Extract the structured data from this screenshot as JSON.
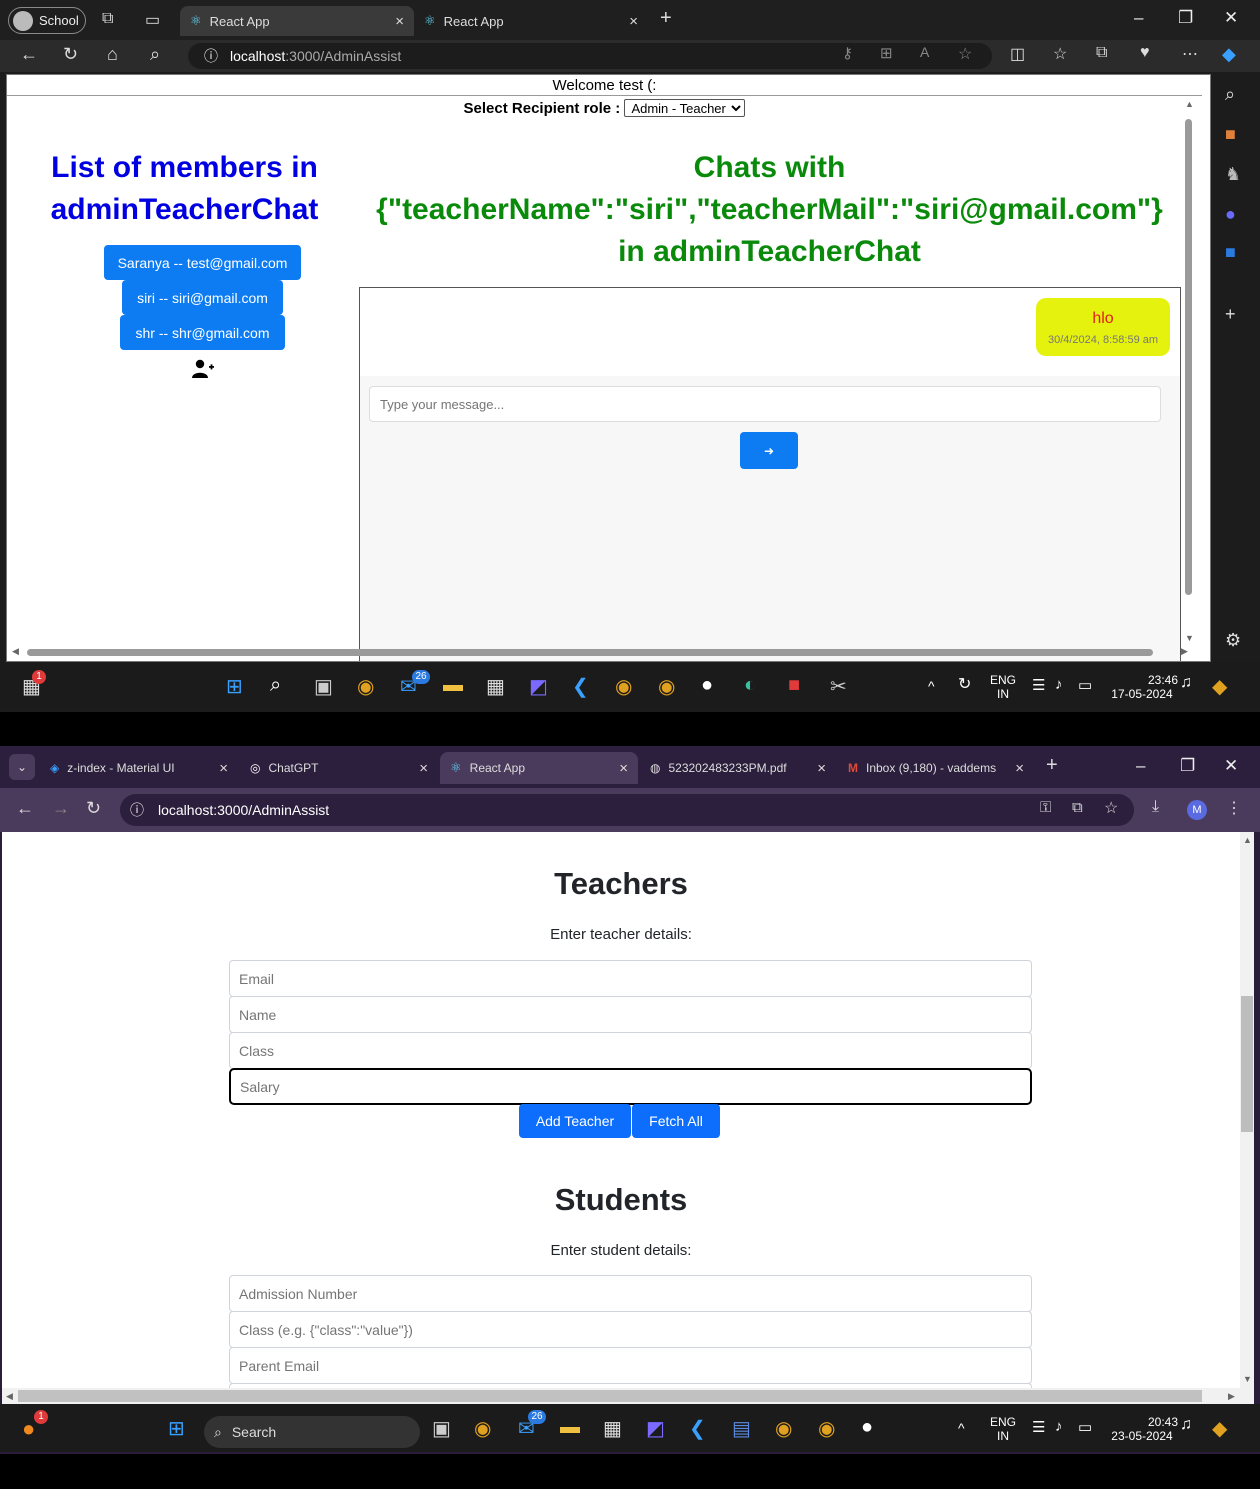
{
  "edge": {
    "profile": "School",
    "tabs": [
      {
        "label": "React App",
        "close": "×"
      },
      {
        "label": "React App",
        "close": "×"
      }
    ],
    "new_tab": "+",
    "url_host": "localhost",
    "url_path": ":3000/AdminAssist",
    "win": {
      "min": "–",
      "max": "❐",
      "close": "✕"
    }
  },
  "chat_page": {
    "welcome": "Welcome test (:",
    "recipient_label": "Select Recipient role :",
    "recipient_value": "Admin - Teacher",
    "members_heading_1": "List of members in",
    "members_heading_2": "adminTeacherChat",
    "members": [
      "Saranya -- test@gmail.com",
      "siri -- siri@gmail.com",
      "shr -- shr@gmail.com"
    ],
    "chats_heading_1": "Chats with",
    "chats_heading_2": "{\"teacherName\":\"siri\",\"teacherMail\":\"siri@gmail.com\"}",
    "chats_heading_3": "in adminTeacherChat",
    "message_text": "hlo",
    "message_time": "30/4/2024, 8:58:59 am",
    "message_placeholder": "Type your message...",
    "send_icon": "➜"
  },
  "taskbar1": {
    "lang_1": "ENG",
    "lang_2": "IN",
    "time": "23:46",
    "date": "17-05-2024",
    "badge": "26",
    "notif": "1"
  },
  "chrome": {
    "tabs": [
      {
        "label": "z-index - Material UI"
      },
      {
        "label": "ChatGPT"
      },
      {
        "label": "React App"
      },
      {
        "label": "523202483233PM.pdf"
      },
      {
        "label": "Inbox (9,180) - vaddems"
      }
    ],
    "url": "localhost:3000/AdminAssist",
    "avatar": "M"
  },
  "admin_page": {
    "teachers_title": "Teachers",
    "teachers_sub": "Enter teacher details:",
    "teacher_fields": [
      "Email",
      "Name",
      "Class",
      "Salary"
    ],
    "add_teacher": "Add Teacher",
    "fetch_all": "Fetch All",
    "students_title": "Students",
    "students_sub": "Enter student details:",
    "student_fields": [
      "Admission Number",
      "Class (e.g. {\"class\":\"value\"})",
      "Parent Email"
    ]
  },
  "taskbar2": {
    "search": "Search",
    "lang_1": "ENG",
    "lang_2": "IN",
    "time": "20:43",
    "date": "23-05-2024",
    "badge": "26",
    "notif": "1"
  }
}
